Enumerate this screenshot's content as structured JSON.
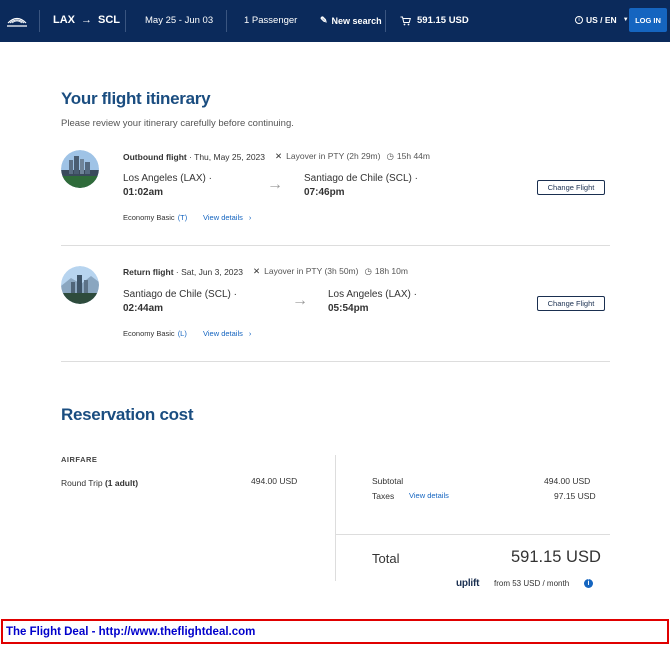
{
  "header": {
    "origin": "LAX",
    "destination": "SCL",
    "dates": "May 25 - Jun 03",
    "passengers": "1 Passenger",
    "new_search": "New search",
    "cart_total": "591.15 USD",
    "locale": "US / EN",
    "login": "LOG IN"
  },
  "itinerary": {
    "title": "Your flight itinerary",
    "subtitle": "Please review your itinerary carefully before continuing.",
    "outbound": {
      "label": "Outbound flight",
      "date": " · Thu, May 25, 2023",
      "layover": "Layover in PTY (2h 29m)",
      "duration": "15h 44m",
      "from_city": "Los Angeles (LAX) ·",
      "from_time": "01:02am",
      "to_city": "Santiago de Chile (SCL) ·",
      "to_time": "07:46pm",
      "fare_class": "Economy Basic",
      "fare_code": "(T)",
      "details": "View details",
      "change": "Change Flight"
    },
    "return": {
      "label": "Return flight",
      "date": " · Sat, Jun 3, 2023",
      "layover": "Layover in PTY (3h 50m)",
      "duration": "18h 10m",
      "from_city": "Santiago de Chile (SCL) ·",
      "from_time": "02:44am",
      "to_city": "Los Angeles (LAX) ·",
      "to_time": "05:54pm",
      "fare_class": "Economy Basic",
      "fare_code": "(L)",
      "details": "View details",
      "change": "Change Flight"
    }
  },
  "cost": {
    "title": "Reservation cost",
    "airfare_label": "AIRFARE",
    "round_trip": "Round Trip",
    "adults": "(1 adult)",
    "round_trip_price": "494.00 USD",
    "subtotal_label": "Subtotal",
    "subtotal": "494.00 USD",
    "taxes_label": "Taxes",
    "taxes_link": "View details",
    "taxes": "97.15 USD",
    "total_label": "Total",
    "total": "591.15 USD",
    "uplift": "uplift",
    "uplift_from": "from 53 USD  / month"
  },
  "footer": {
    "text": "The Flight Deal - http://www.theflightdeal.com"
  },
  "colors": {
    "header_bg": "#0b2a5b",
    "accent": "#1565c0",
    "heading": "#1a4d80",
    "footer_border": "#e00000",
    "footer_text": "#0000cc"
  }
}
